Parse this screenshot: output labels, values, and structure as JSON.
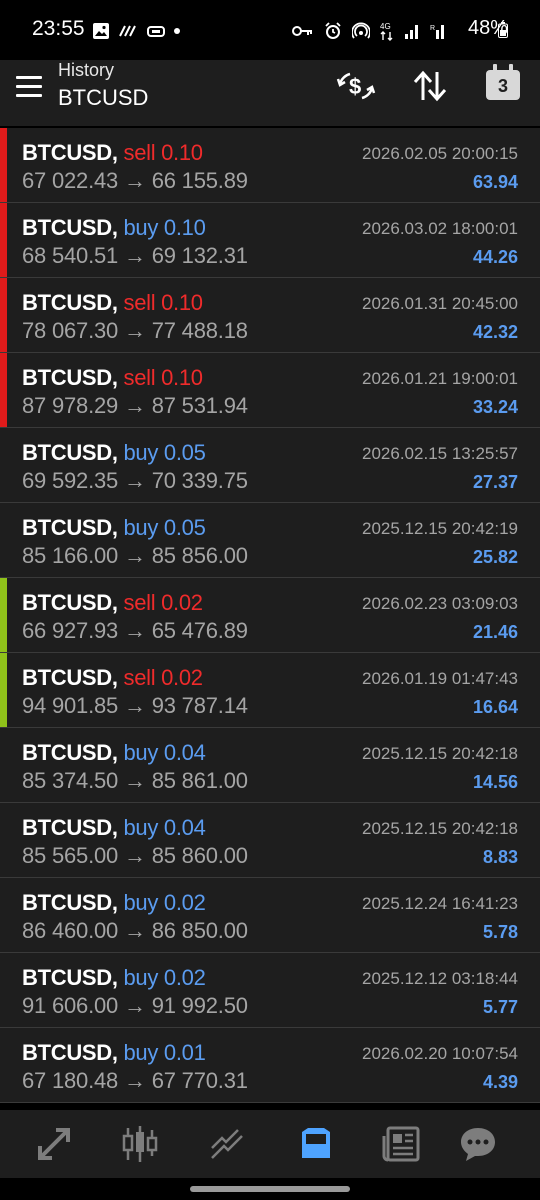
{
  "status_bar": {
    "time": "23:55",
    "battery": "48%"
  },
  "header": {
    "subtitle": "History",
    "title": "BTCUSD",
    "calendar_day": "3"
  },
  "colors": {
    "sell": "#ef2b2b",
    "buy": "#5b9cf0",
    "bar_red": "#e01b1b",
    "bar_green": "#8fc21a"
  },
  "rows": [
    {
      "symbol": "BTCUSD,",
      "side": "sell",
      "volume": "0.10",
      "open": "67 022.43",
      "close": "66 155.89",
      "time": "2026.02.05 20:00:15",
      "profit": "63.94",
      "bar": "red"
    },
    {
      "symbol": "BTCUSD,",
      "side": "buy",
      "volume": "0.10",
      "open": "68 540.51",
      "close": "69 132.31",
      "time": "2026.03.02 18:00:01",
      "profit": "44.26",
      "bar": "red"
    },
    {
      "symbol": "BTCUSD,",
      "side": "sell",
      "volume": "0.10",
      "open": "78 067.30",
      "close": "77 488.18",
      "time": "2026.01.31 20:45:00",
      "profit": "42.32",
      "bar": "red"
    },
    {
      "symbol": "BTCUSD,",
      "side": "sell",
      "volume": "0.10",
      "open": "87 978.29",
      "close": "87 531.94",
      "time": "2026.01.21 19:00:01",
      "profit": "33.24",
      "bar": "red"
    },
    {
      "symbol": "BTCUSD,",
      "side": "buy",
      "volume": "0.05",
      "open": "69 592.35",
      "close": "70 339.75",
      "time": "2026.02.15 13:25:57",
      "profit": "27.37",
      "bar": "none"
    },
    {
      "symbol": "BTCUSD,",
      "side": "buy",
      "volume": "0.05",
      "open": "85 166.00",
      "close": "85 856.00",
      "time": "2025.12.15 20:42:19",
      "profit": "25.82",
      "bar": "none"
    },
    {
      "symbol": "BTCUSD,",
      "side": "sell",
      "volume": "0.02",
      "open": "66 927.93",
      "close": "65 476.89",
      "time": "2026.02.23 03:09:03",
      "profit": "21.46",
      "bar": "green"
    },
    {
      "symbol": "BTCUSD,",
      "side": "sell",
      "volume": "0.02",
      "open": "94 901.85",
      "close": "93 787.14",
      "time": "2026.01.19 01:47:43",
      "profit": "16.64",
      "bar": "green"
    },
    {
      "symbol": "BTCUSD,",
      "side": "buy",
      "volume": "0.04",
      "open": "85 374.50",
      "close": "85 861.00",
      "time": "2025.12.15 20:42:18",
      "profit": "14.56",
      "bar": "none"
    },
    {
      "symbol": "BTCUSD,",
      "side": "buy",
      "volume": "0.04",
      "open": "85 565.00",
      "close": "85 860.00",
      "time": "2025.12.15 20:42:18",
      "profit": "8.83",
      "bar": "none"
    },
    {
      "symbol": "BTCUSD,",
      "side": "buy",
      "volume": "0.02",
      "open": "86 460.00",
      "close": "86 850.00",
      "time": "2025.12.24 16:41:23",
      "profit": "5.78",
      "bar": "none"
    },
    {
      "symbol": "BTCUSD,",
      "side": "buy",
      "volume": "0.02",
      "open": "91 606.00",
      "close": "91 992.50",
      "time": "2025.12.12 03:18:44",
      "profit": "5.77",
      "bar": "none"
    },
    {
      "symbol": "BTCUSD,",
      "side": "buy",
      "volume": "0.01",
      "open": "67 180.48",
      "close": "67 770.31",
      "time": "2026.02.20 10:07:54",
      "profit": "4.39",
      "bar": "none"
    }
  ],
  "bottom_nav": [
    {
      "icon": "quotes-icon",
      "active": false
    },
    {
      "icon": "chart-icon",
      "active": false
    },
    {
      "icon": "trade-icon",
      "active": false
    },
    {
      "icon": "history-icon",
      "active": true
    },
    {
      "icon": "news-icon",
      "active": false
    },
    {
      "icon": "messages-icon",
      "active": false
    }
  ]
}
